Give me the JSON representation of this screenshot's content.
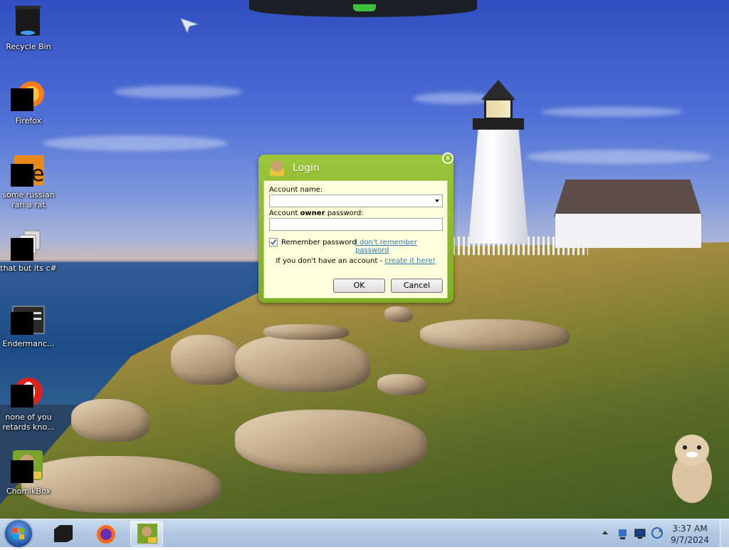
{
  "desktop": {
    "icons": [
      {
        "label": "Recycle Bin",
        "icon": "recycle-bin-icon"
      },
      {
        "label": "Firefox",
        "icon": "firefox-icon"
      },
      {
        "label": "some russian ran a rat",
        "icon": "media-file-icon"
      },
      {
        "label": "that but its c#",
        "icon": "copy-files-icon"
      },
      {
        "label": "Endermanc...",
        "icon": "app-window-icon"
      },
      {
        "label": "none of you retards kno...",
        "icon": "opera-icon"
      },
      {
        "label": "ChomikBox",
        "icon": "chomikbox-icon"
      }
    ]
  },
  "login_dialog": {
    "title": "Login",
    "account_name_label": "Account name:",
    "account_name_value": "",
    "password_label_pre": "Account ",
    "password_label_bold": "owner",
    "password_label_post": " password:",
    "password_value": "",
    "remember_label": "Remember password",
    "remember_checked": true,
    "forgot_link": "I don't remember password",
    "no_account_text": "If you don't have an account - ",
    "create_link": "create it here!",
    "ok_label": "OK",
    "cancel_label": "Cancel",
    "close_glyph": "x"
  },
  "taskbar": {
    "time": "3:37 AM",
    "date": "9/7/2024",
    "pinned": [
      "start-orb-icon",
      "terminal-icon",
      "firefox-icon",
      "chomikbox-icon"
    ]
  },
  "colors": {
    "dialog_green": "#8cba2c",
    "panel_yellow": "#ffffdb",
    "link_blue": "#3577b3",
    "taskbar_blue": "#b2c8e2"
  }
}
